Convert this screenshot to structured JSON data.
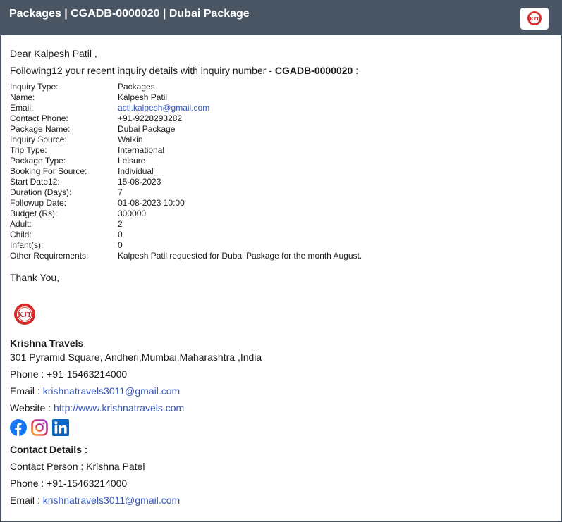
{
  "header": {
    "title": "Packages | CGADB-0000020 | Dubai Package"
  },
  "logo": {
    "text": "KJT"
  },
  "email": {
    "greeting": "Dear Kalpesh Patil ,",
    "intro_prefix": "Following12 your recent inquiry details with inquiry number - ",
    "inquiry_number": "CGADB-0000020",
    "intro_suffix": " :",
    "details": [
      {
        "key": "Inquiry Type:",
        "value": "Packages"
      },
      {
        "key": "Name:",
        "value": "Kalpesh Patil"
      },
      {
        "key": "Email:",
        "value": "actl.kalpesh@gmail.com"
      },
      {
        "key": "Contact Phone:",
        "value": "+91-9228293282"
      },
      {
        "key": "Package Name:",
        "value": "Dubai Package"
      },
      {
        "key": "Inquiry Source:",
        "value": "Walkin"
      },
      {
        "key": "Trip Type:",
        "value": "International"
      },
      {
        "key": "Package Type:",
        "value": "Leisure"
      },
      {
        "key": "Booking For Source:",
        "value": "Individual"
      },
      {
        "key": "Start Date12:",
        "value": "15-08-2023"
      },
      {
        "key": "Duration (Days):",
        "value": "7"
      },
      {
        "key": "Followup Date:",
        "value": "01-08-2023 10:00"
      },
      {
        "key": "Budget (Rs):",
        "value": "300000"
      },
      {
        "key": "Adult:",
        "value": "2"
      },
      {
        "key": "Child:",
        "value": "0"
      },
      {
        "key": "Infant(s):",
        "value": "0"
      },
      {
        "key": "Other Requirements:",
        "value": "Kalpesh Patil requested for Dubai Package for the month August."
      }
    ],
    "thanks": "Thank You,"
  },
  "company": {
    "name": "Krishna Travels",
    "address": "301 Pyramid Square, Andheri,Mumbai,Maharashtra ,India",
    "phone_label": "Phone : ",
    "phone": "+91-15463214000",
    "email_label": "Email : ",
    "email": "krishnatravels3011@gmail.com",
    "website_label": "Website : ",
    "website": "http://www.krishnatravels.com"
  },
  "contact": {
    "title": "Contact Details :",
    "person_label": "Contact Person : ",
    "person": "Krishna Patel",
    "phone_label": "Phone : ",
    "phone": "+91-15463214000",
    "email_label": "Email : ",
    "email": "krishnatravels3011@gmail.com"
  },
  "colors": {
    "header_bg": "#4a5563",
    "link": "#3355bb",
    "facebook": "#1877f2",
    "instagram": "#c13584",
    "linkedin": "#0a66c2",
    "logo_red": "#d62b2b"
  },
  "icons": [
    "facebook-icon",
    "instagram-icon",
    "linkedin-icon"
  ]
}
